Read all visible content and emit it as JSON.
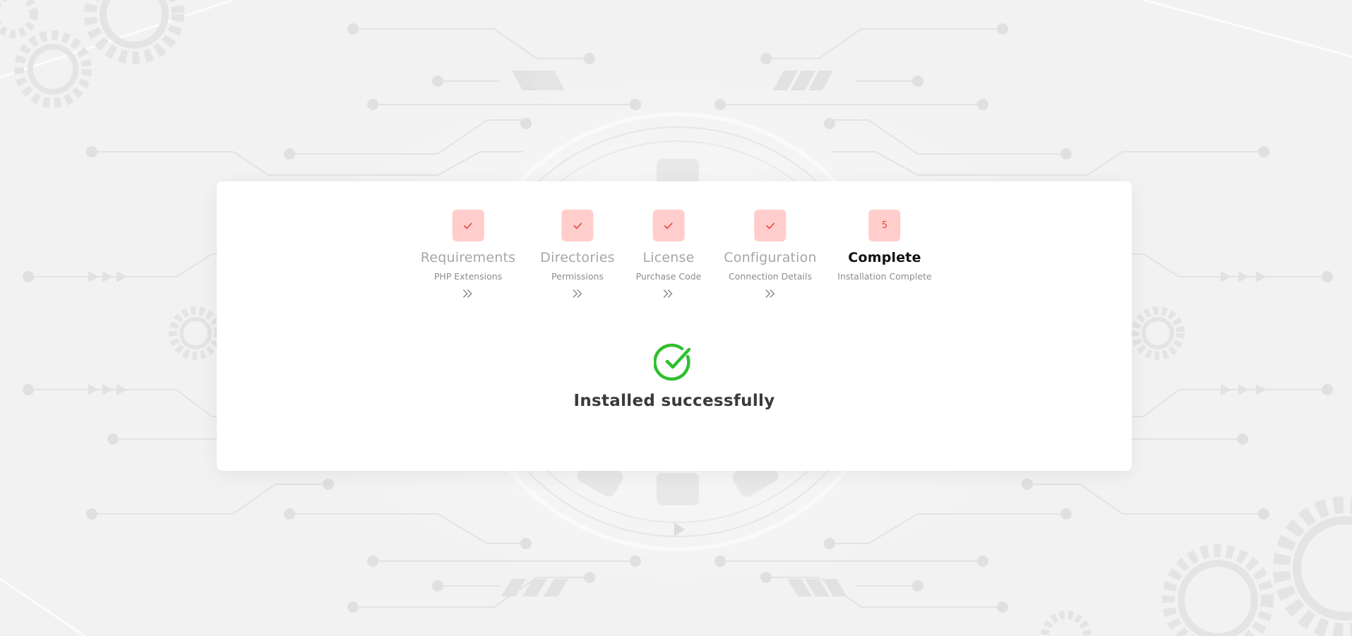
{
  "steps": [
    {
      "badge": "check-icon",
      "title": "Requirements",
      "subtitle": "PHP Extensions",
      "state": "done"
    },
    {
      "badge": "check-icon",
      "title": "Directories",
      "subtitle": "Permissions",
      "state": "done"
    },
    {
      "badge": "check-icon",
      "title": "License",
      "subtitle": "Purchase Code",
      "state": "done"
    },
    {
      "badge": "check-icon",
      "title": "Configuration",
      "subtitle": "Connection Details",
      "state": "done"
    },
    {
      "badge_text": "5",
      "title": "Complete",
      "subtitle": "Installation Complete",
      "state": "active"
    }
  ],
  "separator_icon": "double-chevron-right-icon",
  "success": {
    "icon": "check-circle-icon",
    "message": "Installed successfully"
  },
  "colors": {
    "badge_bg": "#ffcdcb",
    "badge_fg": "#e8453c",
    "success_green": "#2fbf2f",
    "muted_title": "#a6a6a6",
    "active_title": "#111111",
    "page_bg": "#f3f3f3"
  }
}
